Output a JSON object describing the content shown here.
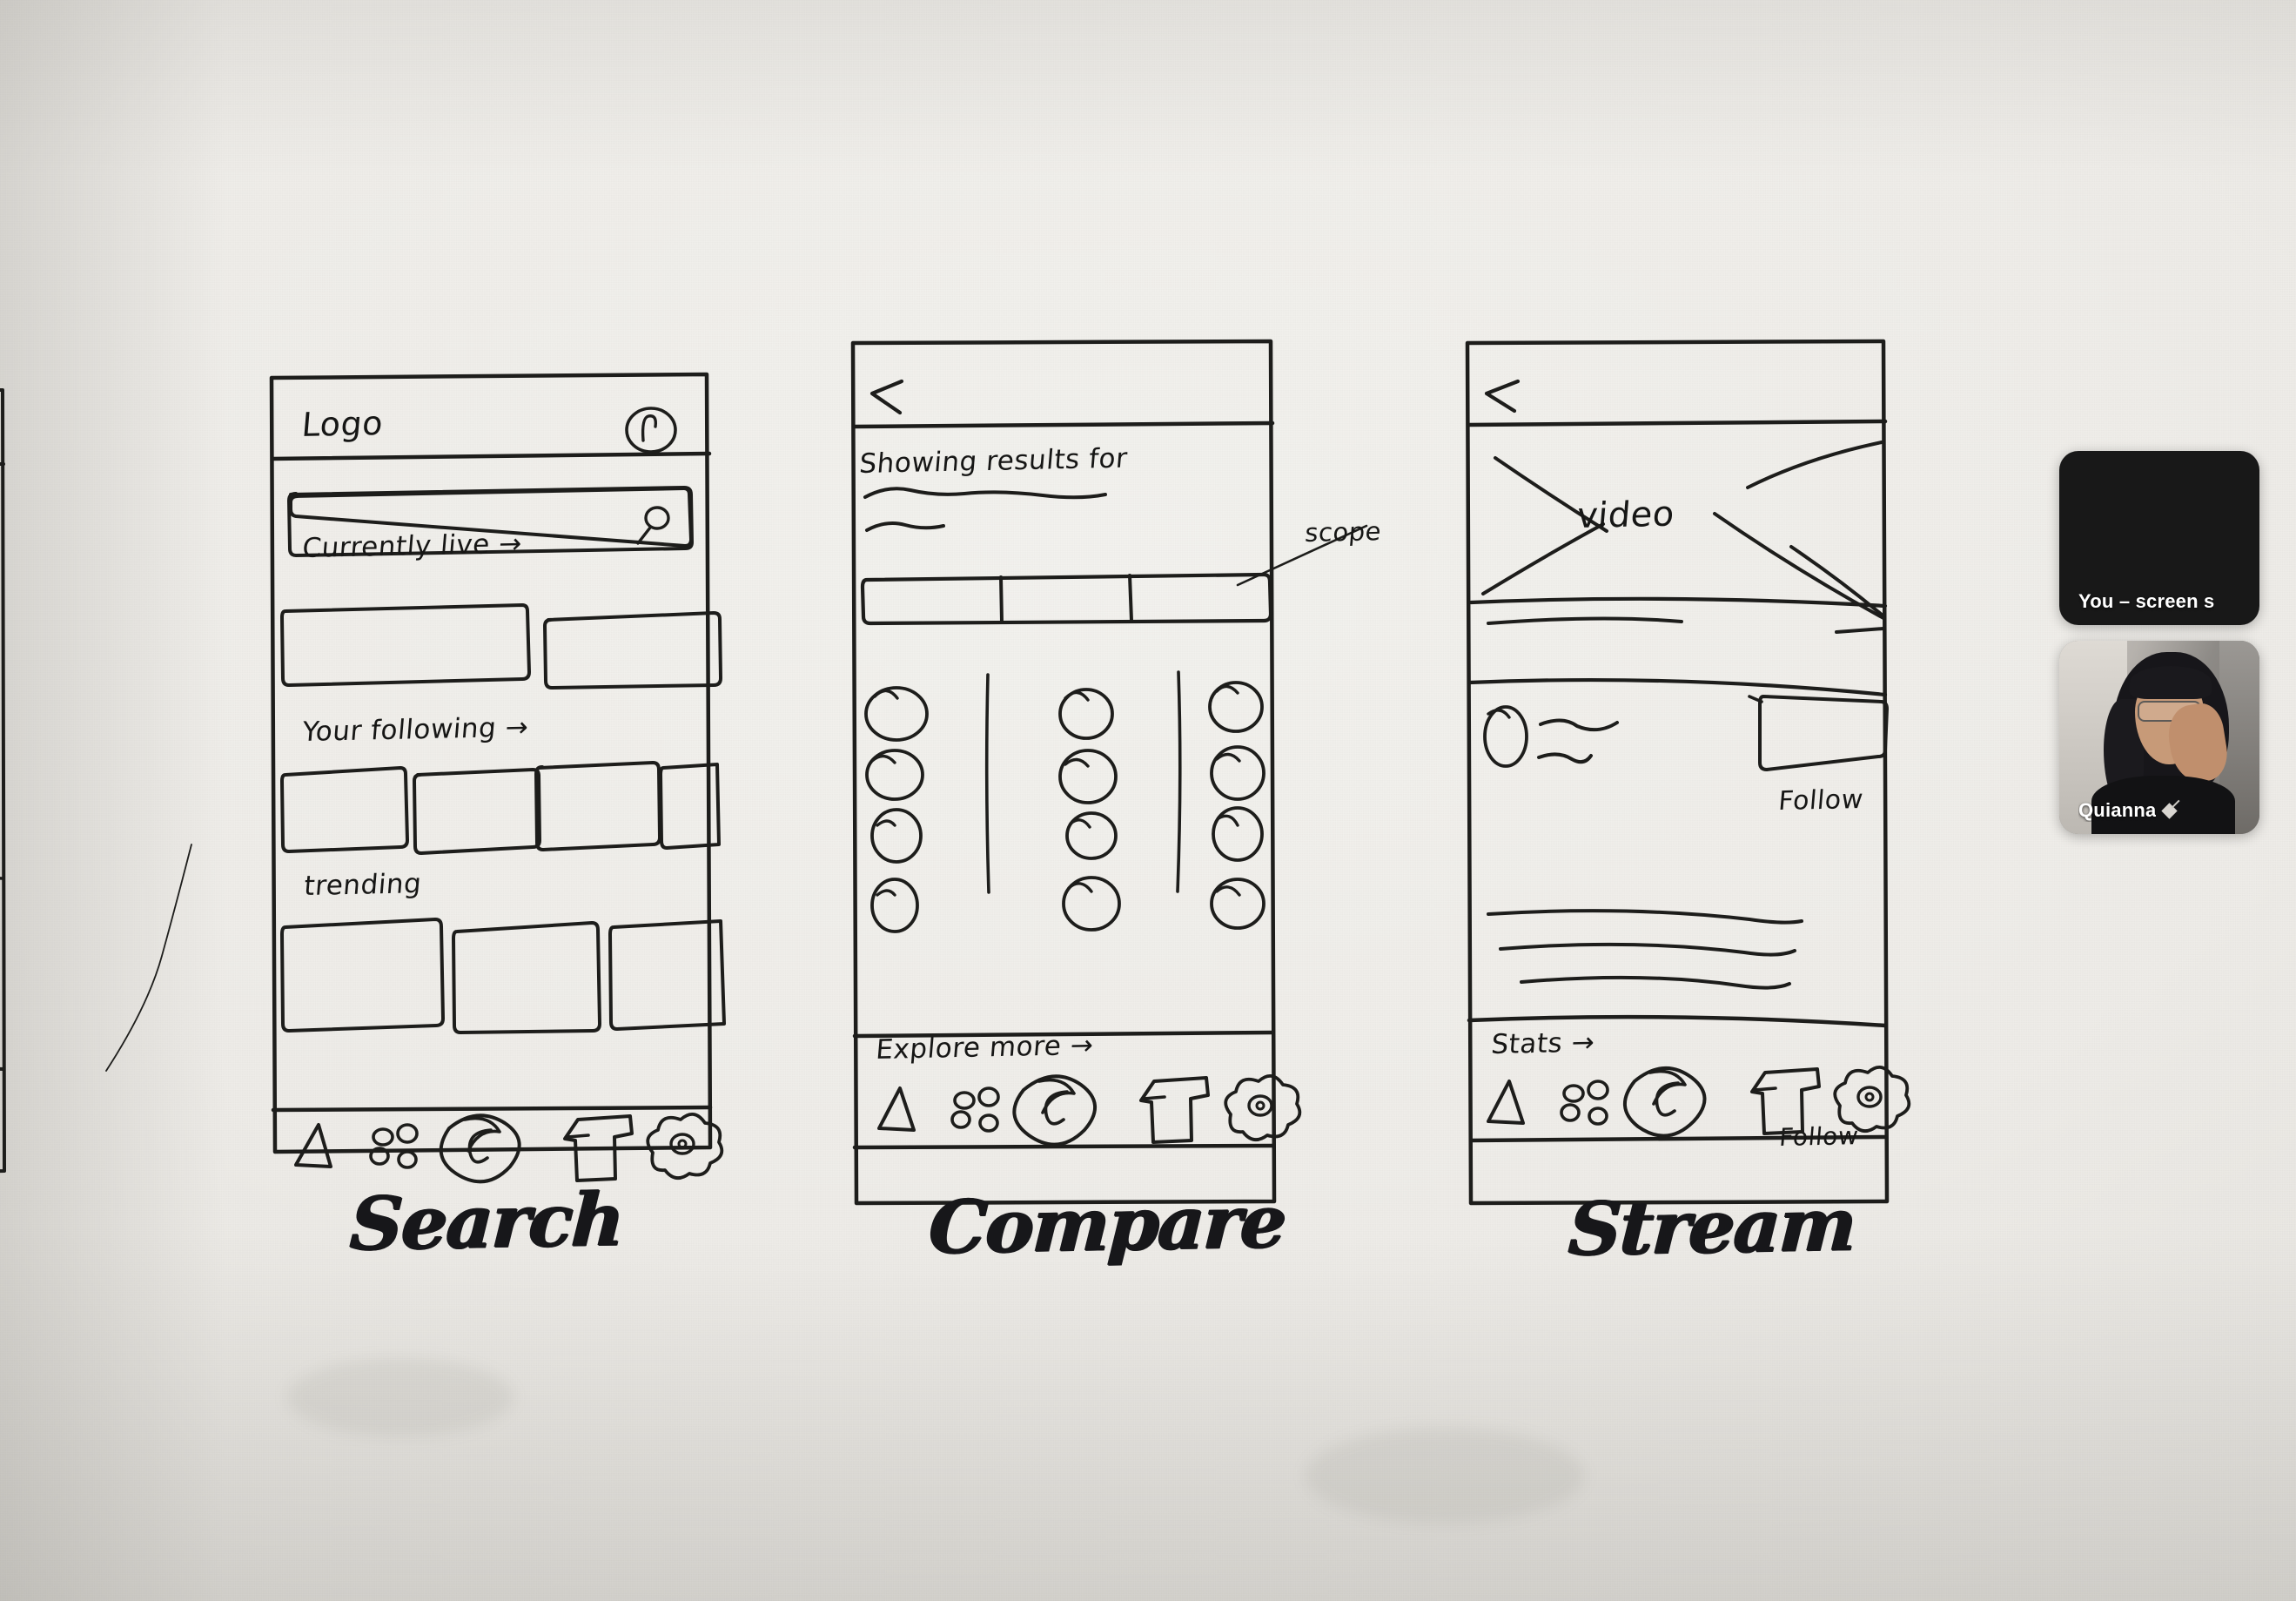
{
  "canvas": {
    "background_color": "#eceae5",
    "ink_color": "#1d1d1b"
  },
  "screens": [
    {
      "id": "partial-left",
      "caption": "",
      "cut_off": true,
      "notes": []
    },
    {
      "id": "search",
      "caption": "Search",
      "header": {
        "logo_label": "Logo",
        "avatar_icon": "avatar-circle-icon"
      },
      "search_bar": {
        "placeholder": "",
        "icon": "magnifying-glass-icon"
      },
      "sections": [
        {
          "label": "Currently live →",
          "cards": 2
        },
        {
          "label": "Your following →",
          "cards": 4
        },
        {
          "label": "trending",
          "cards": 3
        }
      ],
      "bottom_nav": [
        {
          "icon": "triangle-home-icon"
        },
        {
          "icon": "grid-dots-icon"
        },
        {
          "icon": "center-circle-icon"
        },
        {
          "icon": "ticket-icon"
        },
        {
          "icon": "flower-profile-icon"
        }
      ]
    },
    {
      "id": "compare",
      "caption": "Compare",
      "header": {
        "back_icon": "back-chevron-icon"
      },
      "results_label": "Showing results for",
      "placeholder_lines": 2,
      "segmented_bar": {
        "segments": 3,
        "annotation": "scope"
      },
      "grid": {
        "columns": 3,
        "rows": 4,
        "item_icon": "avatar-circle-icon"
      },
      "explore_label": "Explore more →",
      "bottom_nav": [
        {
          "icon": "triangle-home-icon"
        },
        {
          "icon": "grid-dots-icon"
        },
        {
          "icon": "center-circle-icon"
        },
        {
          "icon": "ticket-icon"
        },
        {
          "icon": "flower-profile-icon"
        }
      ]
    },
    {
      "id": "stream",
      "caption": "Stream",
      "header": {
        "back_icon": "back-chevron-icon"
      },
      "video_placeholder": {
        "label": "video",
        "icon": "crossed-box-icon"
      },
      "title_lines": 2,
      "creator_row": {
        "avatar_icon": "avatar-circle-icon",
        "name_lines": 2,
        "follow_label": "Follow"
      },
      "description_lines": 3,
      "stats_label": "Stats →",
      "bottom_nav": [
        {
          "icon": "triangle-home-icon"
        },
        {
          "icon": "grid-dots-icon"
        },
        {
          "icon": "center-circle-icon"
        },
        {
          "icon": "ticket-icon"
        },
        {
          "icon": "flower-profile-icon"
        }
      ]
    }
  ],
  "call_overlay": {
    "tiles": [
      {
        "id": "screen-share",
        "label": "You – screen s",
        "type": "screen"
      },
      {
        "id": "participant",
        "label": "Quianna",
        "type": "camera"
      }
    ]
  }
}
